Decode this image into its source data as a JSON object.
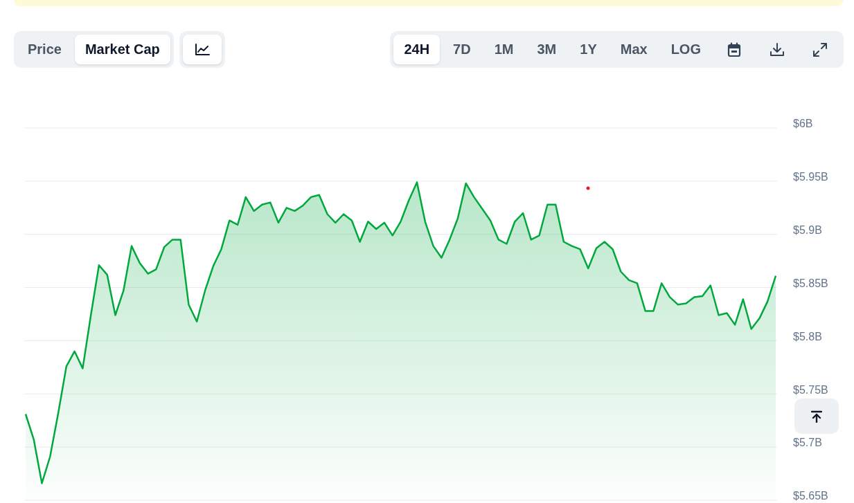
{
  "metric_tabs": [
    {
      "label": "Price",
      "selected": false
    },
    {
      "label": "Market Cap",
      "selected": true
    }
  ],
  "chart_type_button": {
    "selected": true
  },
  "range_tabs": [
    {
      "label": "24H",
      "selected": true
    },
    {
      "label": "7D",
      "selected": false
    },
    {
      "label": "1M",
      "selected": false
    },
    {
      "label": "3M",
      "selected": false
    },
    {
      "label": "1Y",
      "selected": false
    },
    {
      "label": "Max",
      "selected": false
    },
    {
      "label": "LOG",
      "selected": false
    }
  ],
  "chart_data": {
    "type": "area",
    "grid": true,
    "ylim": [
      5.65,
      6
    ],
    "yticks": [
      {
        "value": 6,
        "label": "$6B"
      },
      {
        "value": 5.95,
        "label": "$5.95B"
      },
      {
        "value": 5.9,
        "label": "$5.9B"
      },
      {
        "value": 5.85,
        "label": "$5.85B"
      },
      {
        "value": 5.8,
        "label": "$5.8B"
      },
      {
        "value": 5.75,
        "label": "$5.75B"
      },
      {
        "value": 5.7,
        "label": "$5.7B"
      },
      {
        "value": 5.65,
        "label": "$5.65B"
      }
    ],
    "series": [
      {
        "color": "#00a83e",
        "values": [
          5.731,
          5.707,
          5.666,
          5.691,
          5.732,
          5.776,
          5.79,
          5.774,
          5.824,
          5.871,
          5.862,
          5.824,
          5.847,
          5.889,
          5.873,
          5.863,
          5.867,
          5.888,
          5.895,
          5.895,
          5.834,
          5.818,
          5.847,
          5.87,
          5.886,
          5.913,
          5.909,
          5.935,
          5.922,
          5.928,
          5.93,
          5.911,
          5.925,
          5.922,
          5.927,
          5.935,
          5.937,
          5.919,
          5.911,
          5.919,
          5.913,
          5.893,
          5.912,
          5.905,
          5.911,
          5.899,
          5.912,
          5.932,
          5.949,
          5.912,
          5.889,
          5.878,
          5.895,
          5.915,
          5.948,
          5.935,
          5.924,
          5.913,
          5.895,
          5.891,
          5.912,
          5.92,
          5.895,
          5.899,
          5.928,
          5.928,
          5.893,
          5.889,
          5.886,
          5.868,
          5.887,
          5.893,
          5.886,
          5.865,
          5.857,
          5.854,
          5.828,
          5.828,
          5.854,
          5.841,
          5.834,
          5.835,
          5.841,
          5.842,
          5.852,
          5.824,
          5.826,
          5.815,
          5.839,
          5.811,
          5.821,
          5.837,
          5.861
        ]
      }
    ]
  }
}
